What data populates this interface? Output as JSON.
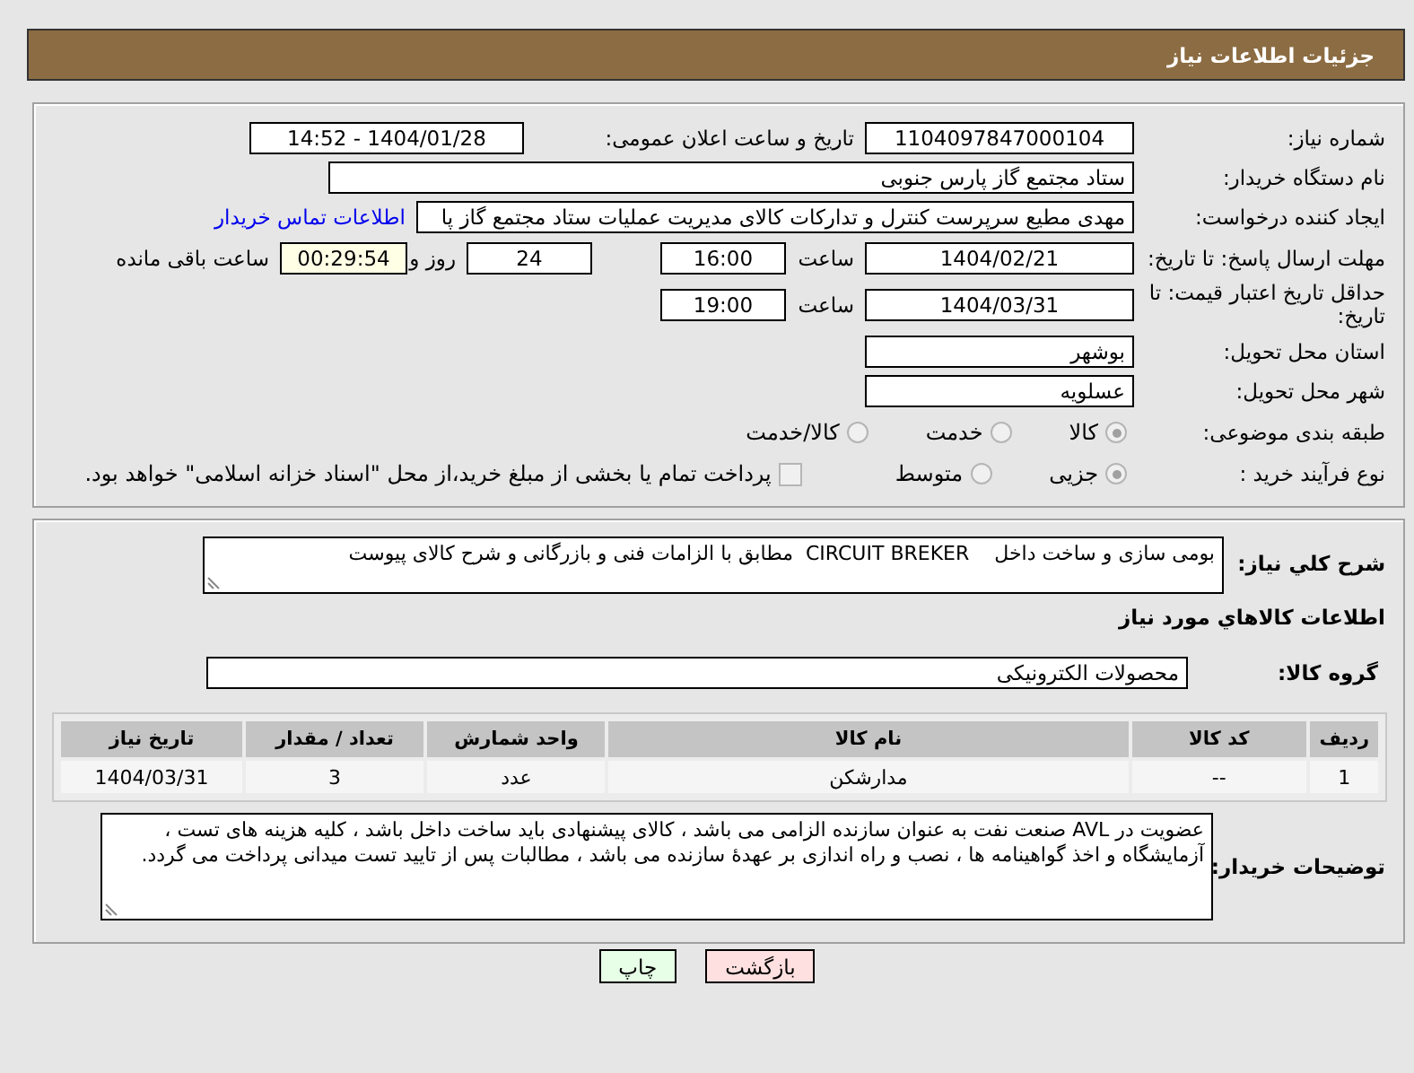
{
  "header": {
    "title": "جزئیات اطلاعات نیاز"
  },
  "need_number": {
    "label": "شماره نیاز:",
    "value": "1104097847000104"
  },
  "announce": {
    "label": "تاریخ و ساعت اعلان عمومی:",
    "value": "1404/01/28 - 14:52"
  },
  "buyer": {
    "label": "نام دستگاه خریدار:",
    "value": "ستاد مجتمع گاز پارس جنوبی"
  },
  "requester": {
    "label": "ایجاد کننده درخواست:",
    "value": "مهدی مطیع سرپرست کنترل و تدارکات کالای مدیریت عملیات ستاد مجتمع گاز پا",
    "link": "اطلاعات تماس خریدار"
  },
  "deadline": {
    "label": "مهلت ارسال پاسخ: تا تاریخ:",
    "date": "1404/02/21",
    "time_label": "ساعت",
    "time": "16:00",
    "days": "24",
    "days_label": "روز و",
    "remaining": "00:29:54",
    "remaining_label": "ساعت باقی مانده"
  },
  "validity": {
    "label": "حداقل تاریخ اعتبار قیمت: تا تاریخ:",
    "date": "1404/03/31",
    "time_label": "ساعت",
    "time": "19:00"
  },
  "province": {
    "label": "استان محل تحویل:",
    "value": "بوشهر"
  },
  "city": {
    "label": "شهر محل تحویل:",
    "value": "عسلویه"
  },
  "category": {
    "label": "طبقه بندی موضوعی:",
    "options": [
      {
        "label": "کالا",
        "selected": true
      },
      {
        "label": "خدمت",
        "selected": false
      },
      {
        "label": "کالا/خدمت",
        "selected": false
      }
    ]
  },
  "process": {
    "label": "نوع فرآیند خرید :",
    "options": [
      {
        "label": "جزیی",
        "selected": true
      },
      {
        "label": "متوسط",
        "selected": false
      }
    ],
    "payment": {
      "label": "پرداخت تمام یا بخشی از مبلغ خرید،از محل \"اسناد خزانه اسلامی\" خواهد بود.",
      "checked": false
    }
  },
  "description": {
    "label": "شرح كلي نياز:",
    "value": "بومی سازی و ساخت داخل    CIRCUIT BREKER  مطابق با الزامات فنی و بازرگانی و شرح کالای پیوست"
  },
  "goods_title": "اطلاعات كالاهاي مورد نياز",
  "goods_group": {
    "label": "گروه كالا:",
    "value": "محصولات الکترونیکی"
  },
  "table": {
    "columns": [
      "ردیف",
      "کد کالا",
      "نام کالا",
      "واحد شمارش",
      "تعداد / مقدار",
      "تاریخ نیاز"
    ],
    "rows": [
      [
        "1",
        "--",
        "مدارشکن",
        "عدد",
        "3",
        "1404/03/31"
      ]
    ]
  },
  "notes": {
    "label": "توضیحات خریدار:",
    "value": "عضویت در AVL صنعت نفت به عنوان سازنده الزامی می باشد ، کالای پیشنهادی باید ساخت داخل باشد ، کلیه هزینه های تست ، آزمایشگاه و اخذ گواهینامه ها ، نصب و راه اندازی بر عهدهٔ سازنده می باشد ، مطالبات پس از تایید تست میدانی پرداخت می گردد."
  },
  "buttons": [
    {
      "kind": "back",
      "label": "بازگشت"
    },
    {
      "kind": "print",
      "label": "چاپ"
    }
  ]
}
